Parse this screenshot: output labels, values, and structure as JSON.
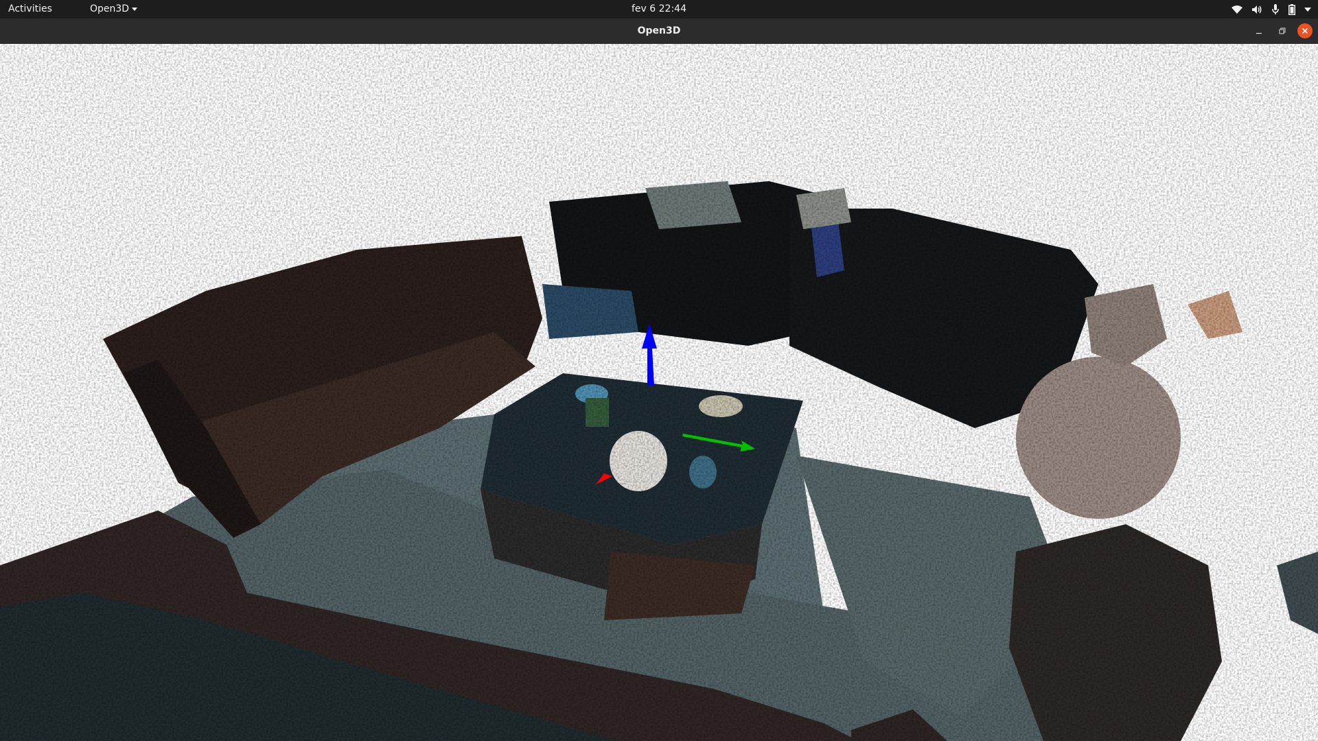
{
  "topbar": {
    "activities_label": "Activities",
    "app_menu_label": "Open3D",
    "clock": "fev 6  22:44",
    "icons": [
      "wifi-icon",
      "volume-icon",
      "microphone-icon",
      "battery-icon",
      "system-menu-chevron-icon"
    ]
  },
  "window": {
    "title": "Open3D",
    "controls": [
      "minimize-icon",
      "maximize-icon",
      "close-icon"
    ],
    "close_color": "#e95420"
  },
  "viewport": {
    "background": "#ffffff",
    "axes": {
      "x_color": "#ff0000",
      "y_color": "#00c000",
      "z_color": "#0000ff"
    }
  }
}
